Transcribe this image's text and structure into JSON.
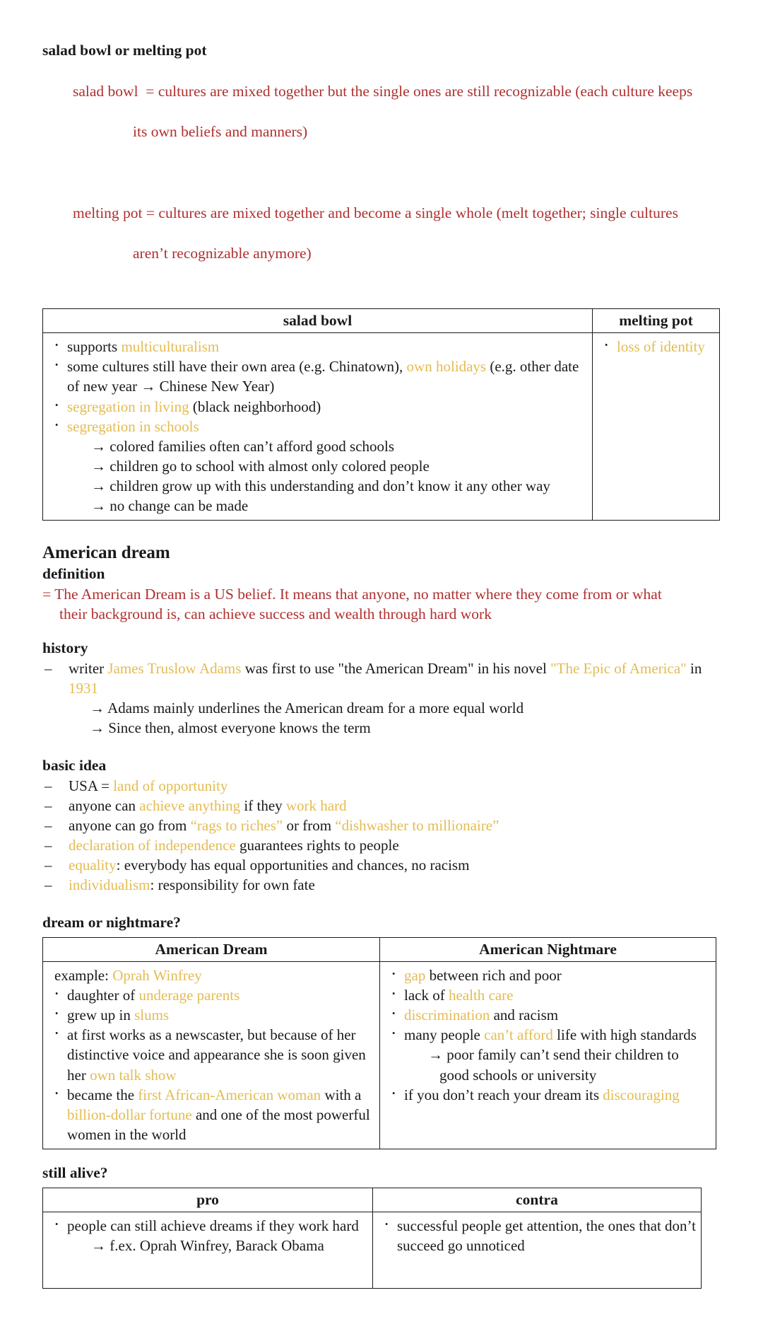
{
  "section_salad": {
    "heading": "salad bowl or melting pot",
    "def_salad_label": "salad bowl  = ",
    "def_salad_text": "cultures are mixed together but the single ones are still recognizable (each culture keeps",
    "def_salad_cont": "its own beliefs and manners)",
    "def_melting_label": "melting pot = ",
    "def_melting_text": "cultures are mixed together and become a single whole (melt together; single cultures",
    "def_melting_cont": "aren’t recognizable anymore)",
    "table": {
      "headers": [
        "salad bowl",
        "melting pot"
      ],
      "left_items": [
        {
          "parts": [
            {
              "t": "supports ",
              "c": "black"
            },
            {
              "t": "multiculturalism",
              "c": "gold"
            }
          ]
        },
        {
          "parts": [
            {
              "t": "some cultures still have their own area (e.g. Chinatown), ",
              "c": "black"
            },
            {
              "t": "own holidays",
              "c": "gold"
            },
            {
              "t": " (e.g. other date of new year →  Chinese New Year)",
              "c": "black"
            }
          ]
        },
        {
          "parts": [
            {
              "t": "segregation in living",
              "c": "gold"
            },
            {
              "t": " (black neighborhood)",
              "c": "black"
            }
          ]
        },
        {
          "parts": [
            {
              "t": "segregation in schools",
              "c": "gold"
            }
          ],
          "sub": [
            "→ colored families often can’t afford good schools",
            "→ children go to school with almost only colored people",
            "→ children grow up with this understanding and don’t know it any other way",
            "→ no change can be made"
          ]
        }
      ],
      "right_items": [
        {
          "parts": [
            {
              "t": "loss of identity",
              "c": "gold"
            }
          ]
        }
      ]
    }
  },
  "section_american_dream": {
    "heading": "American dream",
    "definition_label": "definition",
    "definition_line1": "= The American Dream is a US belief. It means that anyone, no matter where they come from or what",
    "definition_line2": "their background is, can achieve success and wealth through hard work",
    "history_label": "history",
    "history_items": [
      {
        "parts": [
          {
            "t": "writer ",
            "c": "black"
          },
          {
            "t": "James Truslow Adams",
            "c": "gold"
          },
          {
            "t": " was first to use \"the American Dream\" in his novel ",
            "c": "black"
          },
          {
            "t": "\"The Epic of America\"",
            "c": "gold"
          },
          {
            "t": " in ",
            "c": "black"
          },
          {
            "t": "1931",
            "c": "gold"
          }
        ]
      }
    ],
    "history_arrows": [
      "→ Adams mainly underlines the American dream for a more equal world",
      "→ Since then, almost everyone knows the term"
    ],
    "basic_idea_label": "basic idea",
    "basic_idea_items": [
      {
        "parts": [
          {
            "t": "USA = ",
            "c": "black"
          },
          {
            "t": "land of opportunity",
            "c": "gold"
          }
        ]
      },
      {
        "parts": [
          {
            "t": "anyone can ",
            "c": "black"
          },
          {
            "t": "achieve anything",
            "c": "gold"
          },
          {
            "t": " if they ",
            "c": "black"
          },
          {
            "t": "work hard",
            "c": "gold"
          }
        ]
      },
      {
        "parts": [
          {
            "t": "anyone can go from ",
            "c": "black"
          },
          {
            "t": "“rags to riches”",
            "c": "gold"
          },
          {
            "t": " or from ",
            "c": "black"
          },
          {
            "t": "“dishwasher to millionaire”",
            "c": "gold"
          }
        ]
      },
      {
        "parts": [
          {
            "t": "declaration of independence",
            "c": "gold"
          },
          {
            "t": " guarantees rights to people",
            "c": "black"
          }
        ]
      },
      {
        "parts": [
          {
            "t": "equality",
            "c": "gold"
          },
          {
            "t": ": everybody has equal opportunities and chances, no racism",
            "c": "black"
          }
        ]
      },
      {
        "parts": [
          {
            "t": "individualism",
            "c": "gold"
          },
          {
            "t": ": responsibility for own fate",
            "c": "black"
          }
        ]
      }
    ]
  },
  "section_dream_nightmare": {
    "heading": "dream or nightmare?",
    "table": {
      "headers": [
        "American Dream",
        "American Nightmare"
      ],
      "left_items": [
        {
          "bullet": false,
          "parts": [
            {
              "t": "example: ",
              "c": "black"
            },
            {
              "t": "Oprah Winfrey",
              "c": "gold"
            }
          ]
        },
        {
          "bullet": true,
          "parts": [
            {
              "t": "daughter of ",
              "c": "black"
            },
            {
              "t": "underage parents",
              "c": "gold"
            }
          ]
        },
        {
          "bullet": true,
          "parts": [
            {
              "t": "grew up in ",
              "c": "black"
            },
            {
              "t": "slums",
              "c": "gold"
            }
          ]
        },
        {
          "bullet": true,
          "parts": [
            {
              "t": "at first works as a newscaster, but because of her distinctive voice and appearance she is soon given her ",
              "c": "black"
            },
            {
              "t": "own talk show",
              "c": "gold"
            }
          ]
        },
        {
          "bullet": true,
          "parts": [
            {
              "t": "became the ",
              "c": "black"
            },
            {
              "t": "first African-American woman",
              "c": "gold"
            },
            {
              "t": " with a ",
              "c": "black"
            },
            {
              "t": "billion-dollar fortune",
              "c": "gold"
            },
            {
              "t": " and one of the most powerful women in the world",
              "c": "black"
            }
          ]
        }
      ],
      "right_items": [
        {
          "bullet": true,
          "parts": [
            {
              "t": "gap",
              "c": "gold"
            },
            {
              "t": " between rich and poor",
              "c": "black"
            }
          ]
        },
        {
          "bullet": true,
          "parts": [
            {
              "t": "lack of ",
              "c": "black"
            },
            {
              "t": "health care",
              "c": "gold"
            }
          ]
        },
        {
          "bullet": true,
          "parts": [
            {
              "t": "discrimination",
              "c": "gold"
            },
            {
              "t": " and racism",
              "c": "black"
            }
          ]
        },
        {
          "bullet": true,
          "parts": [
            {
              "t": "many people ",
              "c": "black"
            },
            {
              "t": "can’t afford",
              "c": "gold"
            },
            {
              "t": " life with high standards",
              "c": "black"
            }
          ],
          "sub": [
            "→ poor family can’t send their children to good schools or university"
          ]
        },
        {
          "bullet": true,
          "parts": [
            {
              "t": "if you don’t reach your dream its ",
              "c": "black"
            },
            {
              "t": "discouraging",
              "c": "gold"
            }
          ]
        }
      ]
    }
  },
  "section_still_alive": {
    "heading": "still alive?",
    "table": {
      "headers": [
        "pro",
        "contra"
      ],
      "left_items": [
        {
          "bullet": true,
          "parts": [
            {
              "t": "people can still achieve dreams if they work hard",
              "c": "black"
            }
          ],
          "sub": [
            "→ f.ex. Oprah Winfrey, Barack Obama"
          ]
        }
      ],
      "right_items": [
        {
          "bullet": true,
          "parts": [
            {
              "t": "successful people get attention, the ones that don’t succeed go unnoticed",
              "c": "black"
            }
          ]
        }
      ]
    }
  },
  "colors": {
    "red": "#b02f2f",
    "gold": "#e3bc52",
    "text": "#1a1a1a",
    "border": "#1a1a1a",
    "background": "#ffffff"
  }
}
